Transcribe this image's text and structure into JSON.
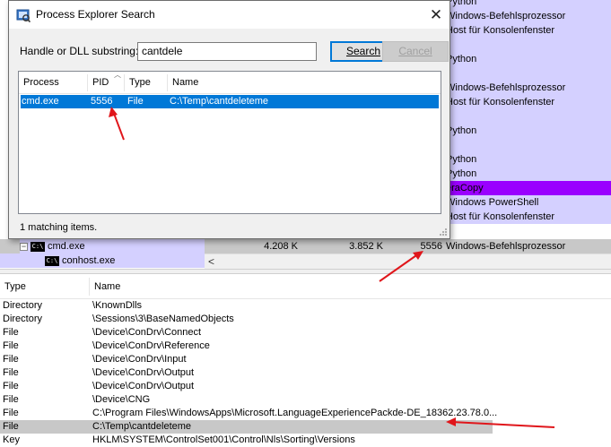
{
  "dialog": {
    "title": "Process Explorer Search",
    "close_glyph": "✕",
    "handle_label": "Handle or DLL substring:",
    "search_value": "cantdele",
    "search_button": "Search",
    "cancel_button": "Cancel",
    "columns": [
      "Process",
      "PID",
      "Type",
      "Name"
    ],
    "result": {
      "process": "cmd.exe",
      "pid": "5556",
      "type": "File",
      "name": "C:\\Temp\\cantdeleteme"
    },
    "status": "1 matching items."
  },
  "background": {
    "desc_rows": [
      {
        "text": "Python",
        "style": "pink"
      },
      {
        "text": "Windows-Befehlsprozessor",
        "style": "pink"
      },
      {
        "text": "Host für Konsolenfenster",
        "style": "pink"
      },
      {
        "text": "",
        "style": "pink"
      },
      {
        "text": "Python",
        "style": "pink"
      },
      {
        "text": "",
        "style": "pink"
      },
      {
        "text": "Windows-Befehlsprozessor",
        "style": "pink"
      },
      {
        "text": "Host für Konsolenfenster",
        "style": "pink"
      },
      {
        "text": "",
        "style": "pink"
      },
      {
        "text": "Python",
        "style": "pink"
      },
      {
        "text": "",
        "style": "pink"
      },
      {
        "text": "Python",
        "style": "pink"
      },
      {
        "text": "Python",
        "style": "pink"
      },
      {
        "text": "eraCopy",
        "style": "purple"
      },
      {
        "text": "Windows PowerShell",
        "style": "pink"
      },
      {
        "text": "Host für Konsolenfenster",
        "style": "pink"
      }
    ],
    "cmd_row": {
      "name": "cmd.exe",
      "private_bytes": "4.208 K",
      "working_set": "3.852 K",
      "pid": "5556",
      "desc": "Windows-Befehlsprozessor"
    },
    "conhost_row": {
      "name": "conhost.exe"
    },
    "scroll_left_glyph": "<"
  },
  "lower": {
    "columns": [
      "Type",
      "Name"
    ],
    "rows": [
      {
        "type": "Directory",
        "name": "\\KnownDlls"
      },
      {
        "type": "Directory",
        "name": "\\Sessions\\3\\BaseNamedObjects"
      },
      {
        "type": "File",
        "name": "\\Device\\ConDrv\\Connect"
      },
      {
        "type": "File",
        "name": "\\Device\\ConDrv\\Reference"
      },
      {
        "type": "File",
        "name": "\\Device\\ConDrv\\Input"
      },
      {
        "type": "File",
        "name": "\\Device\\ConDrv\\Output"
      },
      {
        "type": "File",
        "name": "\\Device\\ConDrv\\Output"
      },
      {
        "type": "File",
        "name": "\\Device\\CNG"
      },
      {
        "type": "File",
        "name": "C:\\Program Files\\WindowsApps\\Microsoft.LanguageExperiencePackde-DE_18362.23.78.0..."
      },
      {
        "type": "File",
        "name": "C:\\Temp\\cantdeleteme",
        "selected": true
      },
      {
        "type": "Key",
        "name": "HKLM\\SYSTEM\\ControlSet001\\Control\\Nls\\Sorting\\Versions"
      }
    ]
  },
  "colors": {
    "accent": "#0078d7",
    "annotation": "#e0161b",
    "service_row": "#d4d0ff",
    "highlight": "#9a00ff"
  }
}
